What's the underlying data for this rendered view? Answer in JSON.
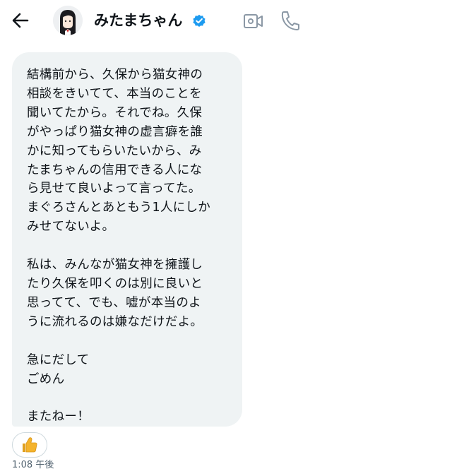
{
  "header": {
    "contact_name": "みたまちゃん",
    "verified": true,
    "back_icon": "arrow-left-icon",
    "video_icon": "video-camera-icon",
    "call_icon": "phone-icon"
  },
  "message": {
    "text": "結構前から、久保から猫女神の\n相談をきいてて、本当のことを\n聞いてたから。それでね。久保\nがやっぱり猫女神の虚言癖を誰\nかに知ってもらいたいから、み\nたまちゃんの信用できる人にな\nら見せて良いよって言ってた。\nまぐろさんとあともう1人にしか\nみせてないよ。\n\n私は、みんなが猫女神を擁護し\nたり久保を叩くのは別に良いと\n思ってて、でも、嘘が本当のよ\nうに流れるのは嫌なだけだよ。\n\n急にだして\nごめん\n\nまたねー！",
    "reaction": "👍",
    "timestamp": "1:08 午後"
  },
  "colors": {
    "bubble_bg": "#eff3f4",
    "verified_blue": "#1d9bf0",
    "icon_gray": "#8b98a5",
    "timestamp_gray": "#536471"
  }
}
